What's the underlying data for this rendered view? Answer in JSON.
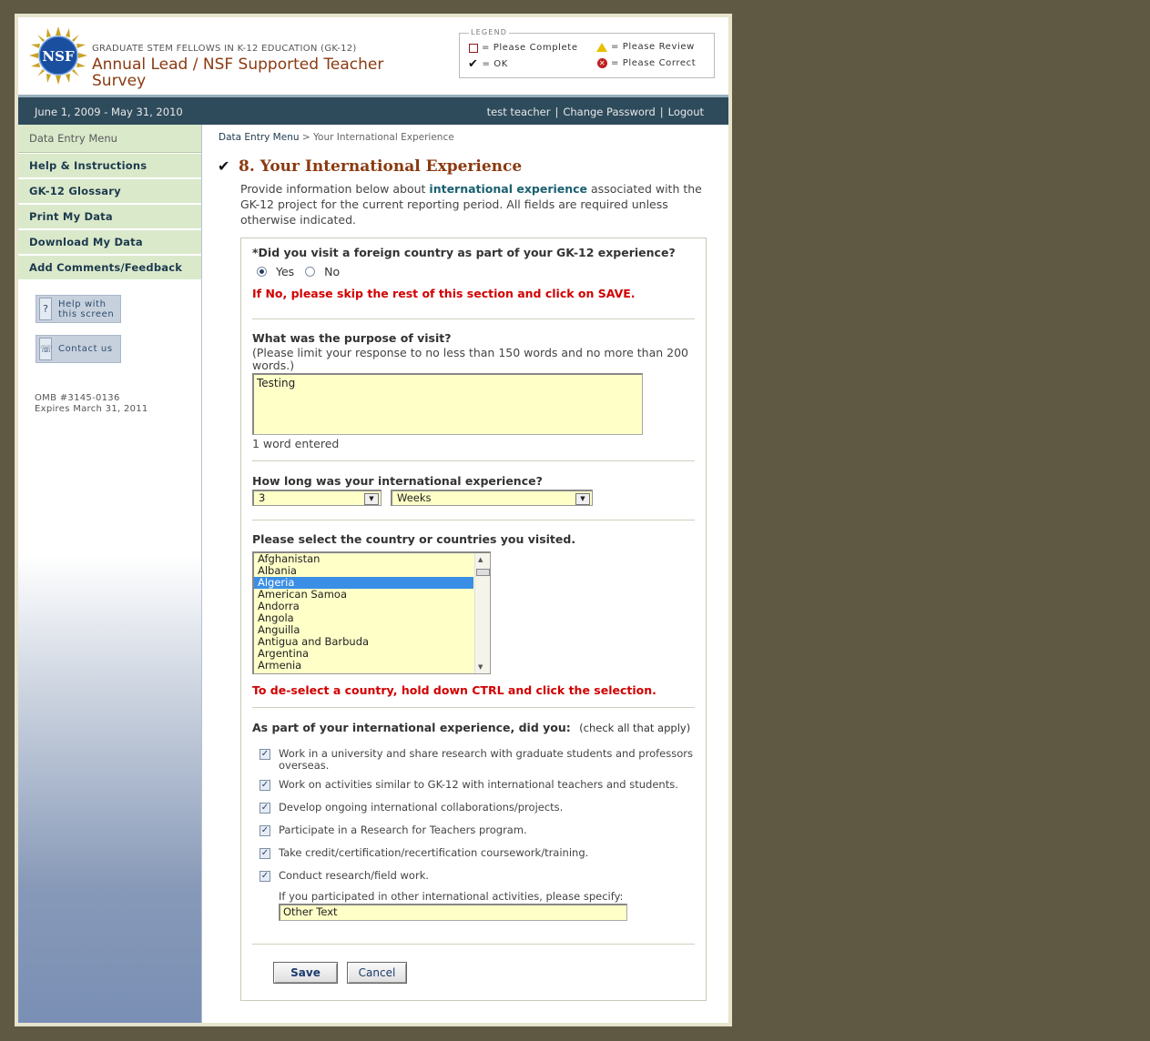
{
  "header": {
    "program": "GRADUATE STEM FELLOWS IN K-12 EDUCATION (GK-12)",
    "title": "Annual Lead / NSF Supported Teacher Survey",
    "logo_text": "NSF"
  },
  "legend": {
    "title": "LEGEND",
    "complete": "= Please Complete",
    "ok": "= OK",
    "review": "= Please Review",
    "correct": "= Please Correct"
  },
  "topbar": {
    "dates": "June 1, 2009 - May 31, 2010",
    "user": "test teacher",
    "change_password": "Change Password",
    "logout": "Logout",
    "separator": "|"
  },
  "sidebar": {
    "menu_title": "Data Entry Menu",
    "items": [
      {
        "label": "Help & Instructions"
      },
      {
        "label": "GK-12 Glossary"
      },
      {
        "label": "Print My Data"
      },
      {
        "label": "Download My Data"
      },
      {
        "label": "Add Comments/Feedback"
      }
    ],
    "help_button": {
      "line1": "Help with",
      "line2": "this screen"
    },
    "contact_button": "Contact us",
    "omb": "OMB #3145-0136",
    "expires": "Expires March 31, 2011"
  },
  "breadcrumb": {
    "root": "Data Entry Menu",
    "separator": ">",
    "current": "Your International Experience"
  },
  "section": {
    "title": "8. Your International Experience",
    "intro_pre": "Provide information below about ",
    "intro_bold": "international experience",
    "intro_post": " associated with the GK-12 project for the current reporting period. All fields are required unless otherwise indicated."
  },
  "q_visit": {
    "question": "*Did you visit a foreign country as part of your GK-12 experience?",
    "yes": "Yes",
    "no": "No",
    "selected": "Yes",
    "warning": "If No, please skip the rest of this section and click on SAVE."
  },
  "q_purpose": {
    "question": "What was the purpose of visit?",
    "note": "(Please limit your response to no less than 150 words and no more than 200 words.)",
    "value": "Testing",
    "word_count": "1 word entered"
  },
  "q_duration": {
    "question": "How long was your international experience?",
    "amount": "3",
    "unit": "Weeks"
  },
  "q_countries": {
    "question": "Please select the country or countries you visited.",
    "options": [
      "Afghanistan",
      "Albania",
      "Algeria",
      "American Samoa",
      "Andorra",
      "Angola",
      "Anguilla",
      "Antigua and Barbuda",
      "Argentina",
      "Armenia"
    ],
    "selected": "Algeria",
    "warning": "To de-select a country, hold down CTRL and click the selection."
  },
  "q_activities": {
    "question": "As part of your international experience, did you:",
    "hint": "(check all that apply)",
    "options": [
      {
        "label": "Work in a university and share research with graduate students and professors overseas.",
        "checked": true
      },
      {
        "label": "Work on activities similar to GK-12 with international teachers and students.",
        "checked": true
      },
      {
        "label": "Develop ongoing international collaborations/projects.",
        "checked": true
      },
      {
        "label": "Participate in a Research for Teachers program.",
        "checked": true
      },
      {
        "label": "Take credit/certification/recertification coursework/training.",
        "checked": true
      },
      {
        "label": "Conduct research/field work.",
        "checked": true
      }
    ],
    "other_label": "If you participated in other international activities, please specify:",
    "other_value": "Other Text"
  },
  "buttons": {
    "save": "Save",
    "cancel": "Cancel"
  },
  "colors": {
    "background": "#5f5944",
    "topbar": "#2e4b5c",
    "menu": "#dbe9cb",
    "title": "#8a3a10",
    "warning": "#d10000",
    "input": "#ffffc8"
  }
}
